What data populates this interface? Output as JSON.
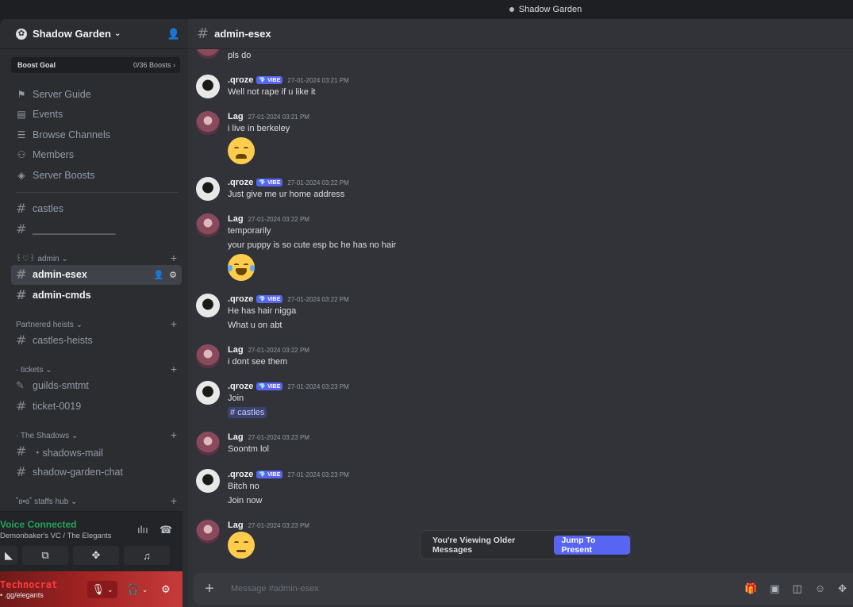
{
  "window": {
    "title": "Shadow Garden"
  },
  "sidebar": {
    "server_name": "Shadow Garden",
    "boost": {
      "label": "Boost Goal",
      "value": "0/36 Boosts ›"
    },
    "nav": [
      {
        "label": "Server Guide",
        "icon": "signpost-icon"
      },
      {
        "label": "Events",
        "icon": "calendar-icon"
      },
      {
        "label": "Browse Channels",
        "icon": "browse-icon"
      },
      {
        "label": "Members",
        "icon": "members-icon"
      },
      {
        "label": "Server Boosts",
        "icon": "boost-icon"
      }
    ],
    "channels_top": [
      "castles",
      "_______________"
    ],
    "cat_admin": "꒰♡꒱ admin ⌄",
    "admin_channels": [
      "admin-esex",
      "admin-cmds"
    ],
    "cat_partnered": "Partnered heists ⌄",
    "partnered_channels": [
      "castles-heists"
    ],
    "cat_tickets": "·       tickets ⌄",
    "ticket_channels": [
      "guilds-smtmt",
      "ticket-0019"
    ],
    "cat_shadows": "·       The Shadows ⌄",
    "shadow_channels": [
      "・shadows-mail",
      "shadow-garden-chat"
    ],
    "cat_staffs": "˚ʚ•ɞ˚ staffs hub ⌄"
  },
  "voice": {
    "status": "Voice Connected",
    "channel": "Demonbaker's VC / The Elegants"
  },
  "user": {
    "name": "Technocrat",
    "status": "• .gg/elegants"
  },
  "chat": {
    "channel": "admin-esex",
    "messages": [
      {
        "text": "pls do"
      },
      {
        "author": ".qroze",
        "tag": "💎 VIBE",
        "time": "27-01-2024 03:21 PM",
        "lines": [
          "Well not rape if u like it"
        ]
      },
      {
        "author": "Lag",
        "time": "27-01-2024 03:21 PM",
        "lines": [
          "i live in berkeley"
        ]
      },
      {
        "author": ".qroze",
        "tag": "💎 VIBE",
        "time": "27-01-2024 03:22 PM",
        "lines": [
          "Just give me ur home address"
        ]
      },
      {
        "author": "Lag",
        "time": "27-01-2024 03:22 PM",
        "lines": [
          "temporarily",
          "your puppy is so cute esp bc he has no hair"
        ]
      },
      {
        "author": ".qroze",
        "tag": "💎 VIBE",
        "time": "27-01-2024 03:22 PM",
        "lines": [
          "He has hair nigga",
          "What u on abt"
        ]
      },
      {
        "author": "Lag",
        "time": "27-01-2024 03:22 PM",
        "lines": [
          "i dont see them"
        ]
      },
      {
        "author": ".qroze",
        "tag": "💎 VIBE",
        "time": "27-01-2024 03:23 PM",
        "lines": [
          "Join"
        ],
        "mention": "# castles"
      },
      {
        "author": "Lag",
        "time": "27-01-2024 03:23 PM",
        "lines": [
          "Soontm lol"
        ]
      },
      {
        "author": ".qroze",
        "tag": "💎 VIBE",
        "time": "27-01-2024 03:23 PM",
        "lines": [
          "Bitch no",
          "Join now"
        ]
      },
      {
        "author": "Lag",
        "time": "27-01-2024 03:23 PM",
        "lines": []
      }
    ],
    "older_banner": {
      "text": "You're Viewing Older Messages",
      "button": "Jump To Present"
    },
    "composer_placeholder": "Message #admin-esex"
  }
}
